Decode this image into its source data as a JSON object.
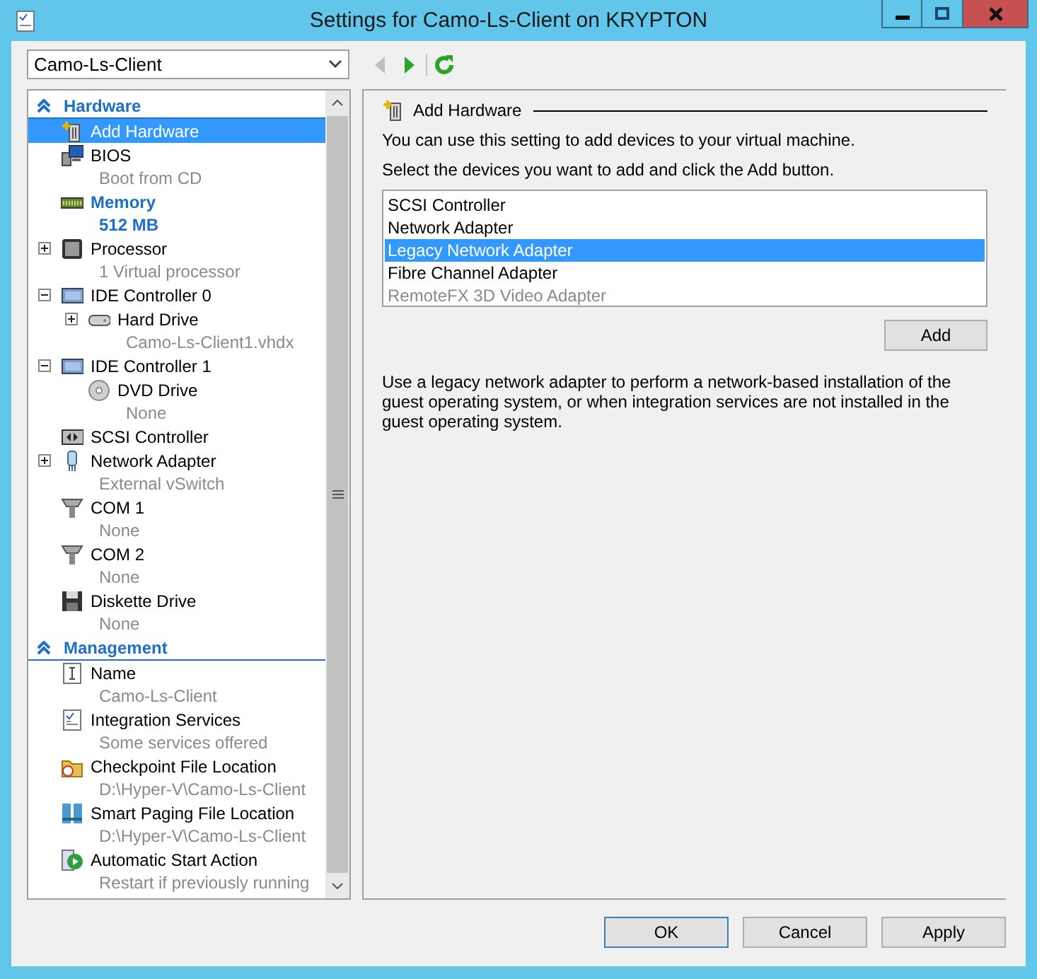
{
  "window": {
    "title": "Settings for Camo-Ls-Client on KRYPTON"
  },
  "vm_selector": {
    "value": "Camo-Ls-Client"
  },
  "nav": [
    {
      "kind": "back",
      "disabled": true
    },
    {
      "kind": "forward",
      "disabled": false
    },
    {
      "kind": "refresh",
      "disabled": false
    }
  ],
  "sidebar": {
    "sections": [
      {
        "title": "Hardware",
        "items": [
          {
            "kind": "addhw",
            "label": "Add Hardware",
            "selected": true,
            "emphasized": false
          },
          {
            "kind": "bios",
            "label": "BIOS",
            "detail": "Boot from CD",
            "selected": false,
            "emphasized": false
          },
          {
            "kind": "memory",
            "label": "Memory",
            "detail": "512 MB",
            "selected": false,
            "emphasized": true
          },
          {
            "kind": "processor",
            "label": "Processor",
            "detail": "1 Virtual processor",
            "selected": false,
            "emphasized": false,
            "expanded": false
          },
          {
            "kind": "controller",
            "label": "IDE Controller 0",
            "selected": false,
            "emphasized": false,
            "expanded": true,
            "children": [
              {
                "kind": "disk",
                "label": "Hard Drive",
                "detail": "Camo-Ls-Client1.vhdx",
                "selected": false,
                "emphasized": false,
                "expanded": false
              }
            ]
          },
          {
            "kind": "controller",
            "label": "IDE Controller 1",
            "selected": false,
            "emphasized": false,
            "expanded": true,
            "children": [
              {
                "kind": "dvd",
                "label": "DVD Drive",
                "detail": "None",
                "selected": false,
                "emphasized": false
              }
            ]
          },
          {
            "kind": "scsi",
            "label": "SCSI Controller",
            "selected": false,
            "emphasized": false
          },
          {
            "kind": "network",
            "label": "Network Adapter",
            "detail": "External vSwitch",
            "selected": false,
            "emphasized": false,
            "expanded": false
          },
          {
            "kind": "port",
            "label": "COM 1",
            "detail": "None",
            "selected": false,
            "emphasized": false
          },
          {
            "kind": "port",
            "label": "COM 2",
            "detail": "None",
            "selected": false,
            "emphasized": false
          },
          {
            "kind": "floppy",
            "label": "Diskette Drive",
            "detail": "None",
            "selected": false,
            "emphasized": false
          }
        ]
      },
      {
        "title": "Management",
        "items": [
          {
            "kind": "name",
            "label": "Name",
            "detail": "Camo-Ls-Client",
            "selected": false,
            "emphasized": false
          },
          {
            "kind": "services",
            "label": "Integration Services",
            "detail": "Some services offered",
            "selected": false,
            "emphasized": false
          },
          {
            "kind": "checkpoint",
            "label": "Checkpoint File Location",
            "detail": "D:\\Hyper-V\\Camo-Ls-Client",
            "selected": false,
            "emphasized": false
          },
          {
            "kind": "paging",
            "label": "Smart Paging File Location",
            "detail": "D:\\Hyper-V\\Camo-Ls-Client",
            "selected": false,
            "emphasized": false
          },
          {
            "kind": "start",
            "label": "Automatic Start Action",
            "detail": "Restart if previously running",
            "selected": false,
            "emphasized": false
          }
        ]
      }
    ]
  },
  "panel": {
    "title": "Add Hardware",
    "intro": "You can use this setting to add devices to your virtual machine.",
    "instruction": "Select the devices you want to add and click the Add button.",
    "devices": [
      {
        "label": "SCSI Controller",
        "selected": false,
        "disabled": false
      },
      {
        "label": "Network Adapter",
        "selected": false,
        "disabled": false
      },
      {
        "label": "Legacy Network Adapter",
        "selected": true,
        "disabled": false
      },
      {
        "label": "Fibre Channel Adapter",
        "selected": false,
        "disabled": false
      },
      {
        "label": "RemoteFX 3D Video Adapter",
        "selected": false,
        "disabled": true
      }
    ],
    "add_button": "Add",
    "description": "Use a legacy network adapter to perform a network-based installation of the guest operating system, or when integration services are not installed in the guest operating system."
  },
  "buttons": [
    {
      "label": "OK",
      "default": true
    },
    {
      "label": "Cancel",
      "default": false
    },
    {
      "label": "Apply",
      "default": false
    }
  ]
}
